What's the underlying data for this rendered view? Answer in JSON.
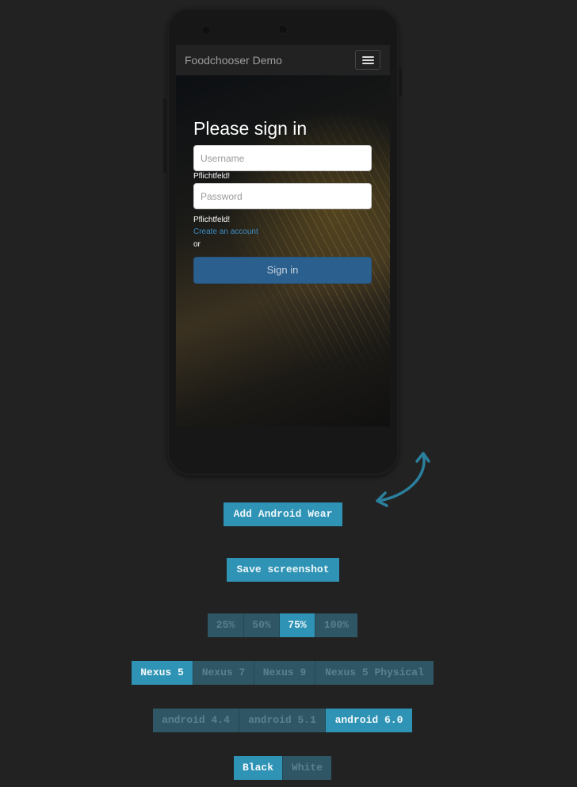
{
  "app": {
    "title": "Foodchooser Demo",
    "menu_icon": "hamburger-menu-icon"
  },
  "signin": {
    "heading": "Please sign in",
    "username_placeholder": "Username",
    "username_value": "",
    "username_error": "Pflichtfeld!",
    "password_placeholder": "Password",
    "password_value": "",
    "password_error": "Pflichtfeld!",
    "create_account": "Create an account",
    "or_text": "or",
    "signin_button": "Sign in"
  },
  "controls": {
    "rotate_icon": "rotate-arrow-icon",
    "add_wear": "Add Android Wear",
    "save_screenshot": "Save screenshot",
    "zoom": {
      "options": [
        "25%",
        "50%",
        "75%",
        "100%"
      ],
      "selected": "75%"
    },
    "devices": {
      "options": [
        "Nexus 5",
        "Nexus 7",
        "Nexus 9",
        "Nexus 5 Physical"
      ],
      "selected": "Nexus 5"
    },
    "android_versions": {
      "options": [
        "android 4.4",
        "android 5.1",
        "android 6.0"
      ],
      "selected": "android 6.0"
    },
    "colors": {
      "options": [
        "Black",
        "White"
      ],
      "selected": "Black"
    }
  },
  "colors": {
    "page_background": "#222222",
    "accent": "#2e93b5",
    "inactive_segment": "#2f5664",
    "link": "#3c8dc5",
    "signin_button": "#2a5f8e"
  }
}
